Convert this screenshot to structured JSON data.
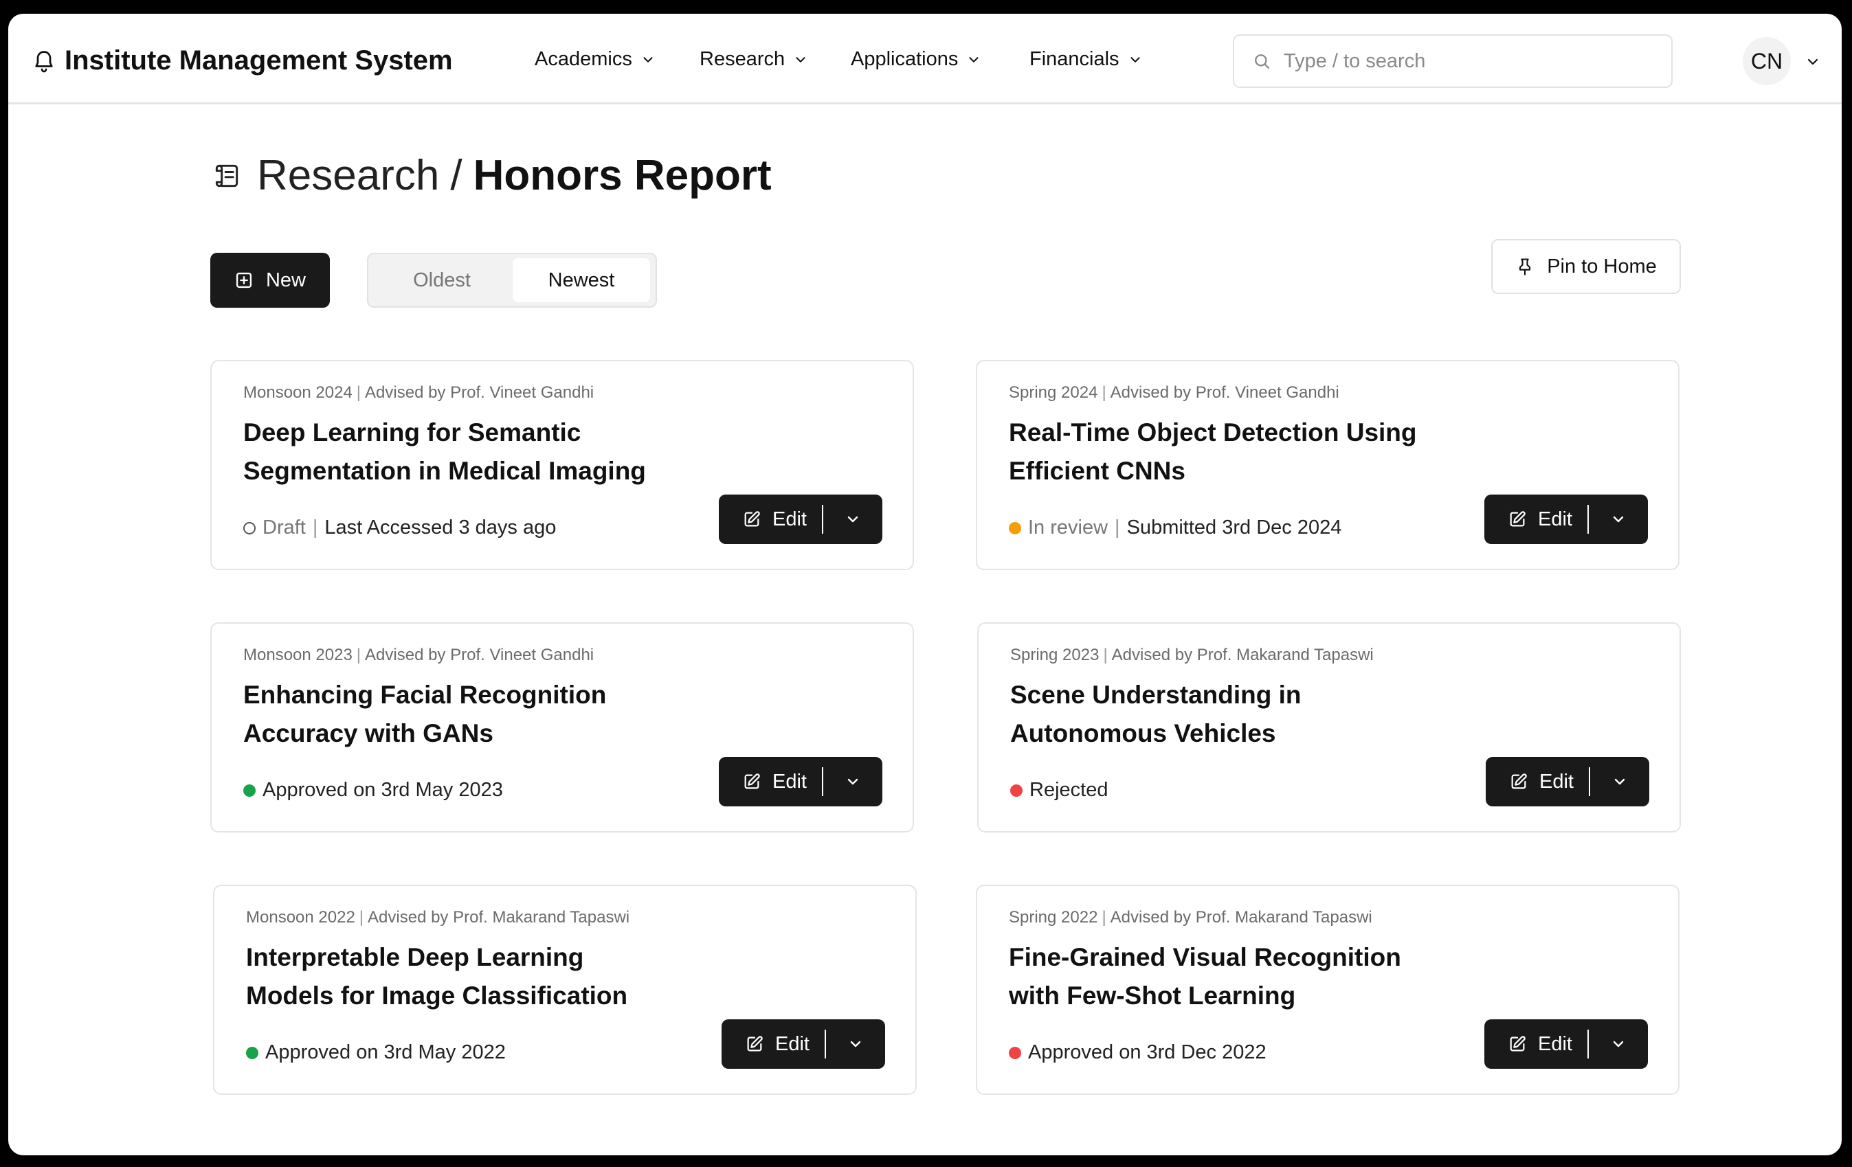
{
  "app": {
    "title": "Institute Management System",
    "logo_icon": "bell-icon"
  },
  "nav": [
    {
      "label": "Academics"
    },
    {
      "label": "Research"
    },
    {
      "label": "Applications"
    },
    {
      "label": "Financials"
    }
  ],
  "search": {
    "placeholder": "Type / to search"
  },
  "user": {
    "initials": "CN"
  },
  "breadcrumb": {
    "parent": "Research",
    "separator": "/",
    "current": "Honors Report",
    "icon": "scroll-icon"
  },
  "toolbar": {
    "new_label": "New",
    "sort_options": [
      "Oldest",
      "Newest"
    ],
    "sort_selected": "Newest",
    "pin_label": "Pin to Home"
  },
  "colors": {
    "primary_dark": "#1a1a1a",
    "draft": "#555555",
    "in_review": "#f59e0b",
    "approved": "#16a34a",
    "rejected": "#ef4444"
  },
  "cards": [
    {
      "term": "Monsoon 2024",
      "advisor": "Advised by Prof. Vineet Gandhi",
      "title_line1": "Deep Learning for Semantic",
      "title_line2": "Segmentation in Medical Imaging",
      "status": "Draft",
      "status_kind": "draft",
      "extra": "Last Accessed 3 days ago",
      "edit_label": "Edit"
    },
    {
      "term": "Spring 2024",
      "advisor": "Advised by Prof. Vineet Gandhi",
      "title_line1": "Real-Time Object Detection Using",
      "title_line2": "Efficient CNNs",
      "status": "In review",
      "status_kind": "in_review",
      "extra": "Submitted 3rd Dec 2024",
      "edit_label": "Edit"
    },
    {
      "term": "Monsoon 2023",
      "advisor": "Advised by Prof. Vineet Gandhi",
      "title_line1": "Enhancing Facial Recognition",
      "title_line2": "Accuracy with GANs",
      "status": "Approved on 3rd May 2023",
      "status_kind": "approved",
      "extra": "",
      "edit_label": "Edit"
    },
    {
      "term": "Spring 2023",
      "advisor": "Advised by Prof. Makarand Tapaswi",
      "title_line1": "Scene Understanding in",
      "title_line2": "Autonomous Vehicles",
      "status": "Rejected",
      "status_kind": "rejected",
      "extra": "",
      "edit_label": "Edit"
    },
    {
      "term": "Monsoon 2022",
      "advisor": "Advised by Prof. Makarand Tapaswi",
      "title_line1": "Interpretable Deep Learning",
      "title_line2": "Models for Image Classification",
      "status": "Approved on 3rd May 2022",
      "status_kind": "approved",
      "extra": "",
      "edit_label": "Edit"
    },
    {
      "term": "Spring 2022",
      "advisor": "Advised by Prof. Makarand Tapaswi",
      "title_line1": "Fine-Grained Visual Recognition",
      "title_line2": "with Few-Shot Learning",
      "status": "Approved on 3rd Dec 2022",
      "status_kind": "rejected",
      "extra": "",
      "edit_label": "Edit"
    }
  ]
}
